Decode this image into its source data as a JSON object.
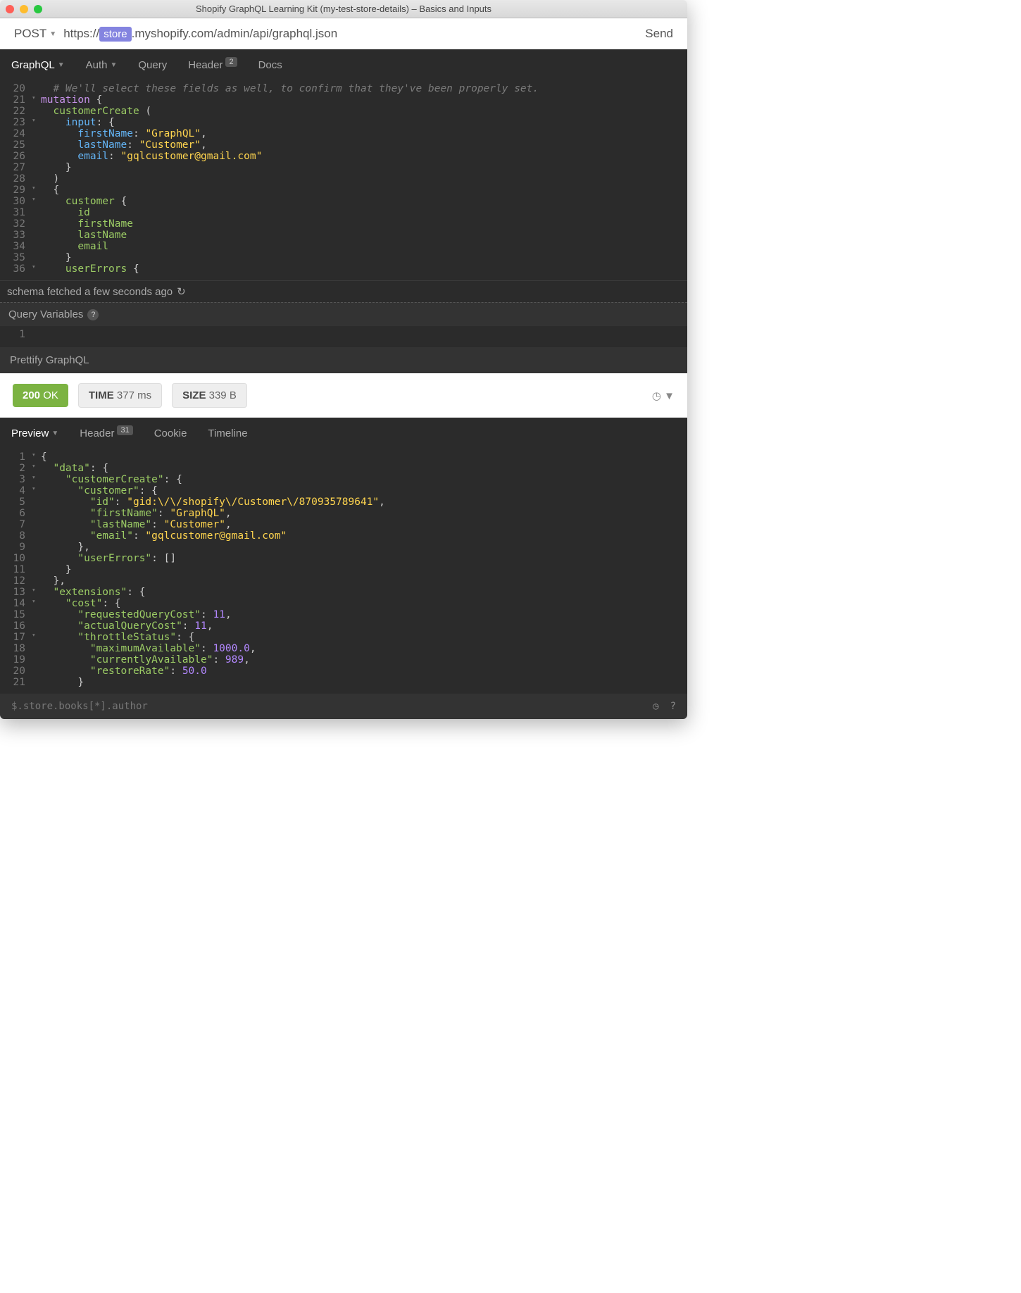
{
  "window_title": "Shopify GraphQL Learning Kit (my-test-store-details) – Basics and Inputs",
  "request": {
    "method": "POST",
    "url_prefix": "https://",
    "url_chip": "store",
    "url_suffix": ".myshopify.com/admin/api/graphql.json",
    "send": "Send"
  },
  "req_tabs": {
    "graphql": "GraphQL",
    "auth": "Auth",
    "query": "Query",
    "header": "Header",
    "header_badge": "2",
    "docs": "Docs"
  },
  "code_lines": [
    {
      "n": 20,
      "fold": false,
      "tokens": [
        [
          "  ",
          ""
        ],
        [
          "# We'll select these fields as well, to confirm that they've been properly set.",
          "c-comment"
        ]
      ]
    },
    {
      "n": 21,
      "fold": true,
      "tokens": [
        [
          "mutation",
          "c-kw"
        ],
        [
          " {",
          ""
        ]
      ]
    },
    {
      "n": 22,
      "fold": false,
      "tokens": [
        [
          "  ",
          ""
        ],
        [
          "customerCreate",
          "c-fn"
        ],
        [
          " (",
          ""
        ]
      ]
    },
    {
      "n": 23,
      "fold": true,
      "tokens": [
        [
          "    ",
          ""
        ],
        [
          "input",
          "c-prop"
        ],
        [
          ": {",
          ""
        ]
      ]
    },
    {
      "n": 24,
      "fold": false,
      "tokens": [
        [
          "      ",
          ""
        ],
        [
          "firstName",
          "c-prop"
        ],
        [
          ": ",
          ""
        ],
        [
          "\"GraphQL\"",
          "c-str"
        ],
        [
          ",",
          ""
        ]
      ]
    },
    {
      "n": 25,
      "fold": false,
      "tokens": [
        [
          "      ",
          ""
        ],
        [
          "lastName",
          "c-prop"
        ],
        [
          ": ",
          ""
        ],
        [
          "\"Customer\"",
          "c-str"
        ],
        [
          ",",
          ""
        ]
      ]
    },
    {
      "n": 26,
      "fold": false,
      "tokens": [
        [
          "      ",
          ""
        ],
        [
          "email",
          "c-prop"
        ],
        [
          ": ",
          ""
        ],
        [
          "\"gqlcustomer@gmail.com\"",
          "c-str"
        ]
      ]
    },
    {
      "n": 27,
      "fold": false,
      "tokens": [
        [
          "    }",
          ""
        ]
      ]
    },
    {
      "n": 28,
      "fold": false,
      "tokens": [
        [
          "  )",
          ""
        ]
      ]
    },
    {
      "n": 29,
      "fold": true,
      "tokens": [
        [
          "  {",
          ""
        ]
      ]
    },
    {
      "n": 30,
      "fold": true,
      "tokens": [
        [
          "    ",
          ""
        ],
        [
          "customer",
          "c-fn"
        ],
        [
          " {",
          ""
        ]
      ]
    },
    {
      "n": 31,
      "fold": false,
      "tokens": [
        [
          "      ",
          ""
        ],
        [
          "id",
          "c-fn"
        ]
      ]
    },
    {
      "n": 32,
      "fold": false,
      "tokens": [
        [
          "      ",
          ""
        ],
        [
          "firstName",
          "c-fn"
        ]
      ]
    },
    {
      "n": 33,
      "fold": false,
      "tokens": [
        [
          "      ",
          ""
        ],
        [
          "lastName",
          "c-fn"
        ]
      ]
    },
    {
      "n": 34,
      "fold": false,
      "tokens": [
        [
          "      ",
          ""
        ],
        [
          "email",
          "c-fn"
        ]
      ]
    },
    {
      "n": 35,
      "fold": false,
      "tokens": [
        [
          "    }",
          ""
        ]
      ]
    },
    {
      "n": 36,
      "fold": true,
      "tokens": [
        [
          "    ",
          ""
        ],
        [
          "userErrors",
          "c-fn"
        ],
        [
          " {",
          ""
        ]
      ]
    }
  ],
  "schema_status": "schema fetched a few seconds ago",
  "query_variables_label": "Query Variables",
  "qvar_line": "1",
  "prettify_label": "Prettify GraphQL",
  "status": {
    "code": "200",
    "text": "OK",
    "time_label": "TIME",
    "time_value": "377 ms",
    "size_label": "SIZE",
    "size_value": "339 B"
  },
  "resp_tabs": {
    "preview": "Preview",
    "header": "Header",
    "header_badge": "31",
    "cookie": "Cookie",
    "timeline": "Timeline"
  },
  "resp_lines": [
    {
      "n": 1,
      "fold": true,
      "tokens": [
        [
          "{",
          ""
        ]
      ]
    },
    {
      "n": 2,
      "fold": true,
      "tokens": [
        [
          "  ",
          ""
        ],
        [
          "\"data\"",
          "c-key"
        ],
        [
          ": {",
          ""
        ]
      ]
    },
    {
      "n": 3,
      "fold": true,
      "tokens": [
        [
          "    ",
          ""
        ],
        [
          "\"customerCreate\"",
          "c-key"
        ],
        [
          ": {",
          ""
        ]
      ]
    },
    {
      "n": 4,
      "fold": true,
      "tokens": [
        [
          "      ",
          ""
        ],
        [
          "\"customer\"",
          "c-key"
        ],
        [
          ": {",
          ""
        ]
      ]
    },
    {
      "n": 5,
      "fold": false,
      "tokens": [
        [
          "        ",
          ""
        ],
        [
          "\"id\"",
          "c-key"
        ],
        [
          ": ",
          ""
        ],
        [
          "\"gid:\\/\\/shopify\\/Customer\\/870935789641\"",
          "c-str"
        ],
        [
          ",",
          ""
        ]
      ]
    },
    {
      "n": 6,
      "fold": false,
      "tokens": [
        [
          "        ",
          ""
        ],
        [
          "\"firstName\"",
          "c-key"
        ],
        [
          ": ",
          ""
        ],
        [
          "\"GraphQL\"",
          "c-str"
        ],
        [
          ",",
          ""
        ]
      ]
    },
    {
      "n": 7,
      "fold": false,
      "tokens": [
        [
          "        ",
          ""
        ],
        [
          "\"lastName\"",
          "c-key"
        ],
        [
          ": ",
          ""
        ],
        [
          "\"Customer\"",
          "c-str"
        ],
        [
          ",",
          ""
        ]
      ]
    },
    {
      "n": 8,
      "fold": false,
      "tokens": [
        [
          "        ",
          ""
        ],
        [
          "\"email\"",
          "c-key"
        ],
        [
          ": ",
          ""
        ],
        [
          "\"gqlcustomer@gmail.com\"",
          "c-str"
        ]
      ]
    },
    {
      "n": 9,
      "fold": false,
      "tokens": [
        [
          "      },",
          ""
        ]
      ]
    },
    {
      "n": 10,
      "fold": false,
      "tokens": [
        [
          "      ",
          ""
        ],
        [
          "\"userErrors\"",
          "c-key"
        ],
        [
          ": []",
          ""
        ]
      ]
    },
    {
      "n": 11,
      "fold": false,
      "tokens": [
        [
          "    }",
          ""
        ]
      ]
    },
    {
      "n": 12,
      "fold": false,
      "tokens": [
        [
          "  },",
          ""
        ]
      ]
    },
    {
      "n": 13,
      "fold": true,
      "tokens": [
        [
          "  ",
          ""
        ],
        [
          "\"extensions\"",
          "c-key"
        ],
        [
          ": {",
          ""
        ]
      ]
    },
    {
      "n": 14,
      "fold": true,
      "tokens": [
        [
          "    ",
          ""
        ],
        [
          "\"cost\"",
          "c-key"
        ],
        [
          ": {",
          ""
        ]
      ]
    },
    {
      "n": 15,
      "fold": false,
      "tokens": [
        [
          "      ",
          ""
        ],
        [
          "\"requestedQueryCost\"",
          "c-key"
        ],
        [
          ": ",
          ""
        ],
        [
          "11",
          "c-num"
        ],
        [
          ",",
          ""
        ]
      ]
    },
    {
      "n": 16,
      "fold": false,
      "tokens": [
        [
          "      ",
          ""
        ],
        [
          "\"actualQueryCost\"",
          "c-key"
        ],
        [
          ": ",
          ""
        ],
        [
          "11",
          "c-num"
        ],
        [
          ",",
          ""
        ]
      ]
    },
    {
      "n": 17,
      "fold": true,
      "tokens": [
        [
          "      ",
          ""
        ],
        [
          "\"throttleStatus\"",
          "c-key"
        ],
        [
          ": {",
          ""
        ]
      ]
    },
    {
      "n": 18,
      "fold": false,
      "tokens": [
        [
          "        ",
          ""
        ],
        [
          "\"maximumAvailable\"",
          "c-key"
        ],
        [
          ": ",
          ""
        ],
        [
          "1000.0",
          "c-num"
        ],
        [
          ",",
          ""
        ]
      ]
    },
    {
      "n": 19,
      "fold": false,
      "tokens": [
        [
          "        ",
          ""
        ],
        [
          "\"currentlyAvailable\"",
          "c-key"
        ],
        [
          ": ",
          ""
        ],
        [
          "989",
          "c-num"
        ],
        [
          ",",
          ""
        ]
      ]
    },
    {
      "n": 20,
      "fold": false,
      "tokens": [
        [
          "        ",
          ""
        ],
        [
          "\"restoreRate\"",
          "c-key"
        ],
        [
          ": ",
          ""
        ],
        [
          "50.0",
          "c-num"
        ]
      ]
    },
    {
      "n": 21,
      "fold": false,
      "tokens": [
        [
          "      }",
          ""
        ]
      ]
    }
  ],
  "footer_placeholder": "$.store.books[*].author"
}
